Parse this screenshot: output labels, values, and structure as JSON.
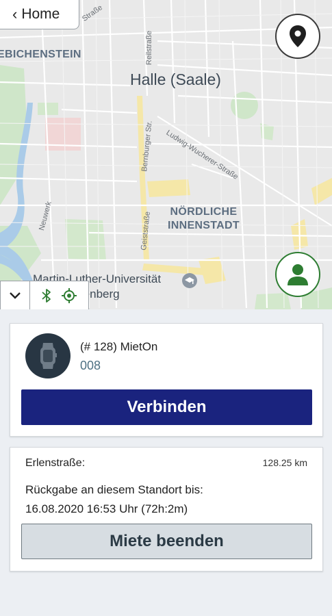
{
  "nav": {
    "home_label": "Home"
  },
  "map": {
    "city_label": "Halle (Saale)",
    "district_top_left": "EBICHENSTEIN",
    "district_center_line1": "NÖRDLICHE",
    "district_center_line2": "INNENSTADT",
    "university_line1": "Martin-Luther-Universität",
    "university_line2": "Halle-Wittenberg",
    "streets": {
      "top_left": "Straße",
      "reilstrasse": "Reilstraße",
      "bernburger": "Bernburger Str.",
      "wucherer": "Ludwig-Wucherer-Straße",
      "geiststrasse": "Geiststraße",
      "neuwerk": "Neuwerk"
    }
  },
  "icons": {
    "location": "map-pin-icon",
    "profile": "person-icon",
    "collapse": "chevron-down-icon",
    "bluetooth": "bluetooth-icon",
    "gps": "gps-fixed-icon",
    "device": "watch-icon"
  },
  "colors": {
    "accent_navy": "#1a237e",
    "status_green": "#2e7d32",
    "secondary_button": "#d7dde2"
  },
  "device": {
    "title": "(# 128) MietOn",
    "subtitle": "008",
    "connect_label": "Verbinden"
  },
  "rental": {
    "street": "Erlenstraße:",
    "distance": "128.25 km",
    "return_text": "Rückgabe an diesem Standort bis:",
    "deadline": "16.08.2020 16:53 Uhr  (72h:2m)",
    "end_label": "Miete beenden"
  }
}
